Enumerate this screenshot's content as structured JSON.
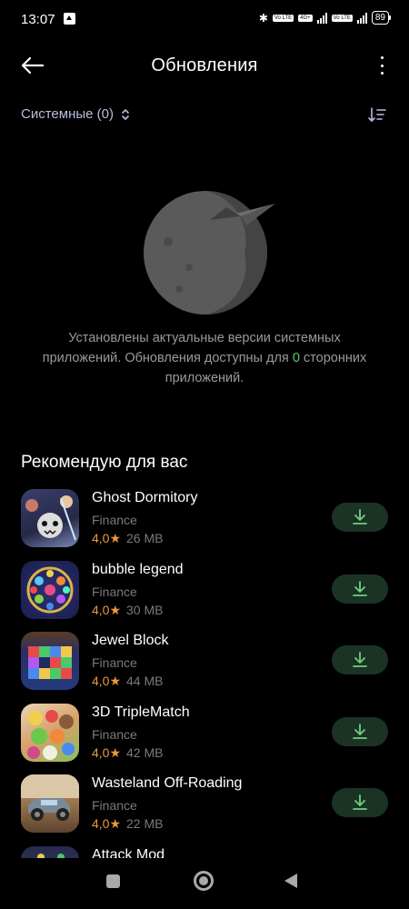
{
  "status_bar": {
    "time": "13:07",
    "bluetooth": "✱",
    "volte1": "Vo LTE",
    "signal_4g": "4G+",
    "volte2": "Vo LTE",
    "battery": "89"
  },
  "header": {
    "title": "Обновления",
    "back_icon": "arrow-left-icon",
    "more_icon": "more-vertical-icon"
  },
  "filter": {
    "label": "Системные (0)",
    "sort_icon": "sort-icon"
  },
  "empty_state": {
    "text_part1": "Установлены актуальные версии системных приложений. Обновления доступны для ",
    "count": "0",
    "text_part2": " сторонних приложений."
  },
  "recommendations": {
    "title": "Рекомендую для вас",
    "apps": [
      {
        "name": "Ghost Dormitory",
        "category": "Finance",
        "rating": "4,0★",
        "size": "26 MB"
      },
      {
        "name": "bubble legend",
        "category": "Finance",
        "rating": "4,0★",
        "size": "30 MB"
      },
      {
        "name": "Jewel Block",
        "category": "Finance",
        "rating": "4,0★",
        "size": "44 MB"
      },
      {
        "name": "3D TripleMatch",
        "category": "Finance",
        "rating": "4,0★",
        "size": "42 MB"
      },
      {
        "name": "Wasteland Off-Roading",
        "category": "Finance",
        "rating": "4,0★",
        "size": "22 MB"
      },
      {
        "name": "Attack Mod",
        "category": "",
        "rating": "",
        "size": ""
      }
    ]
  },
  "colors": {
    "accent_green": "#5ecb6e",
    "install_bg": "#1b3324",
    "rating": "#e89a3c",
    "filter_text": "#b8bde0"
  }
}
